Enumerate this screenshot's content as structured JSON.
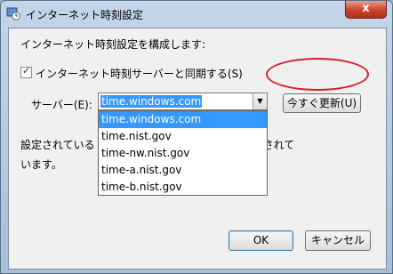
{
  "window": {
    "title": "インターネット時刻設定",
    "ghost_title": "",
    "close_glyph": "x"
  },
  "main": {
    "heading": "インターネット時刻設定を構成します:",
    "sync_checkbox": {
      "checked": true,
      "label": "インターネット時刻サーバーと同期する(S)"
    },
    "server_label": "サーバー(E):",
    "server_value": "time.windows.com",
    "update_button": "今すぐ更新(U)",
    "info_line1_a": "設定されている",
    "info_line1_b": "するように設定されて",
    "info_line2": "います。"
  },
  "dropdown": {
    "options": [
      "time.windows.com",
      "time.nist.gov",
      "time-nw.nist.gov",
      "time-a.nist.gov",
      "time-b.nist.gov"
    ],
    "selected_index": 0
  },
  "footer": {
    "ok": "OK",
    "cancel": "キャンセル"
  },
  "colors": {
    "highlight": "#3399ff",
    "annotation": "#d4202a",
    "close": "#c7432b"
  },
  "icons": [
    "clock-globe-icon",
    "close-icon",
    "checkmark-icon",
    "chevron-down-icon"
  ]
}
